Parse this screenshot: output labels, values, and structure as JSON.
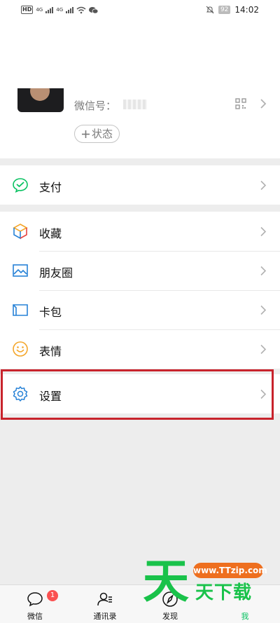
{
  "status_bar": {
    "network_badge": "HD",
    "network_1": "4G",
    "network_2": "4G",
    "battery": "92",
    "time": "14:02"
  },
  "profile": {
    "wechat_id_label": "微信号：",
    "status_label": "状态"
  },
  "menu": {
    "pay": "支付",
    "favorites": "收藏",
    "moments": "朋友圈",
    "cards": "卡包",
    "stickers": "表情",
    "settings": "设置"
  },
  "tabs": [
    {
      "label": "微信",
      "badge": "1"
    },
    {
      "label": "通讯录"
    },
    {
      "label": "发现"
    },
    {
      "label": "我",
      "active": true
    }
  ],
  "watermark": {
    "char": "天",
    "url": "www.TTzip.com",
    "text": "天下载"
  },
  "colors": {
    "accent": "#07c160",
    "highlight": "#c8232c",
    "badge": "#fa5151"
  }
}
